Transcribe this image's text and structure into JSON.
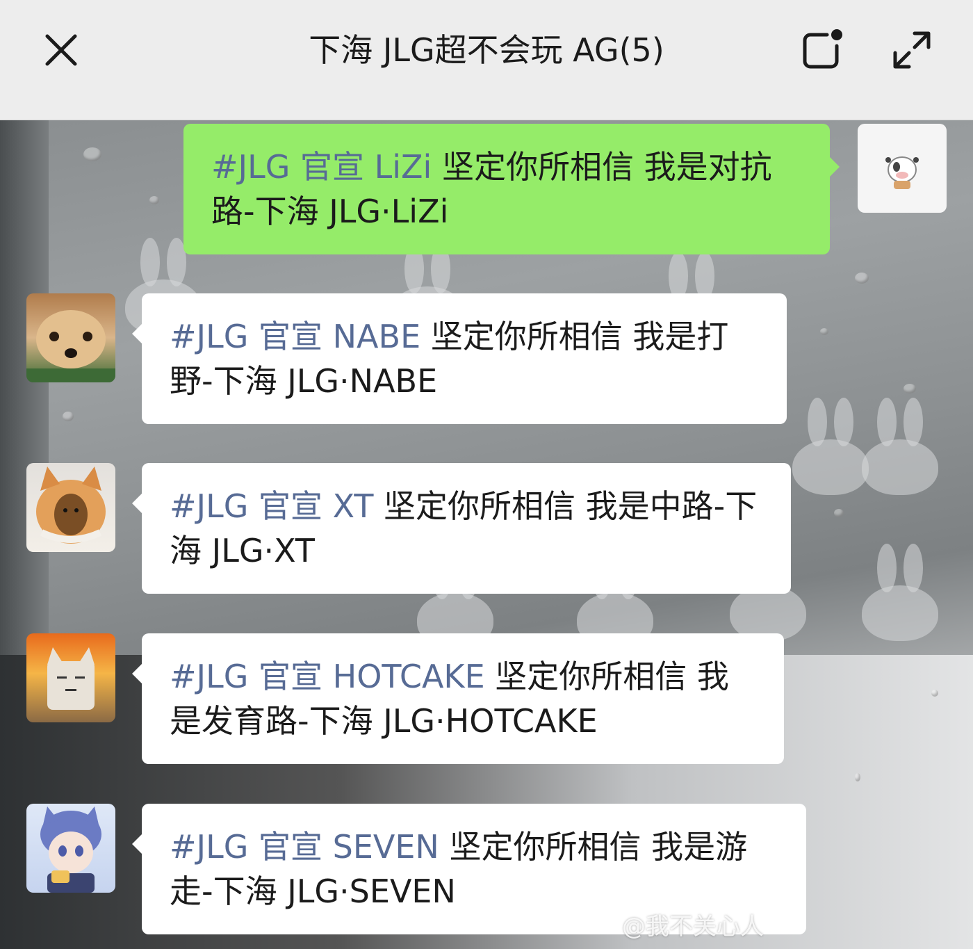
{
  "header": {
    "title": "下海 JLG超不会玩 AG(5)",
    "close_icon": "close-icon",
    "more_icon": "chat-info-icon",
    "expand_icon": "expand-icon"
  },
  "messages": [
    {
      "side": "right",
      "avatar": "cow-avatar",
      "tag": "#JLG 官宣 LiZi",
      "text": " 坚定你所相信 我是对抗路-下海 JLG·LiZi"
    },
    {
      "side": "left",
      "avatar": "dog-avatar",
      "tag": "#JLG 官宣 NABE",
      "text": " 坚定你所相信 我是打野-下海 JLG·NABE"
    },
    {
      "side": "left",
      "avatar": "cat-egg-avatar",
      "tag": "#JLG 官宣 XT",
      "text": " 坚定你所相信 我是中路-下海 JLG·XT"
    },
    {
      "side": "left",
      "avatar": "explosion-cat-avatar",
      "tag": "#JLG 官宣 HOTCAKE",
      "text": " 坚定你所相信 我是发育路-下海 JLG·HOTCAKE"
    },
    {
      "side": "left",
      "avatar": "anime-boy-avatar",
      "tag": "#JLG 官宣 SEVEN",
      "text": " 坚定你所相信 我是游走-下海 JLG·SEVEN"
    }
  ],
  "watermark": "@我不关心人"
}
